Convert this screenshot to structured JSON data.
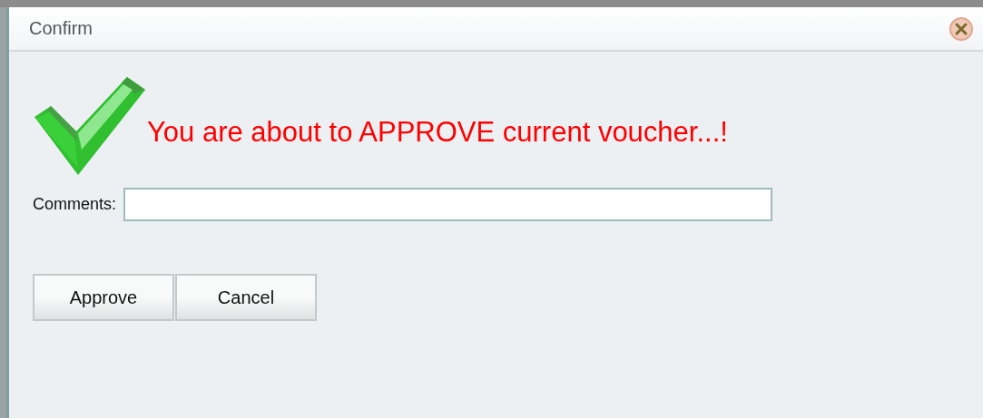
{
  "window": {
    "title": "Confirm"
  },
  "message": "You are about to APPROVE current voucher...!",
  "comments": {
    "label": "Comments:"
  },
  "buttons": [
    {
      "label": "Approve"
    },
    {
      "label": "Cancel"
    }
  ]
}
